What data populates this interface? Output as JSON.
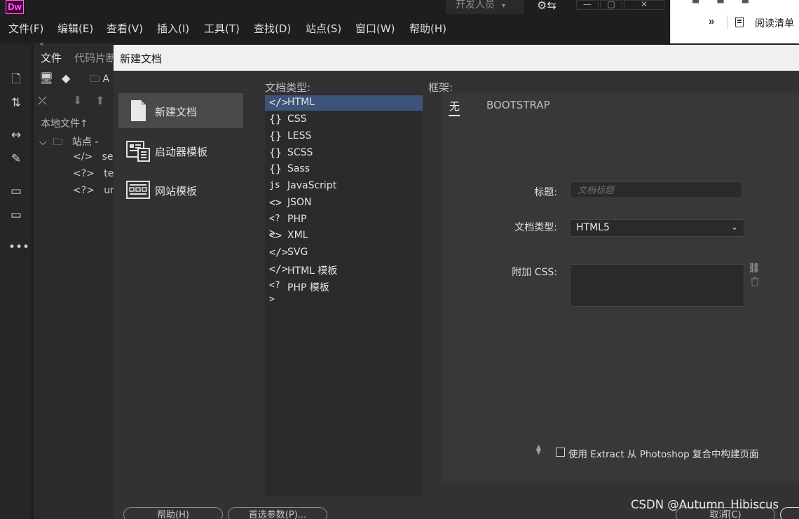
{
  "app": {
    "logo": "Dw",
    "workspace": "开发人员"
  },
  "browser": {
    "more": "»",
    "reading_list": "阅读清单"
  },
  "menu": [
    "文件(F)",
    "编辑(E)",
    "查看(V)",
    "插入(I)",
    "工具(T)",
    "查找(D)",
    "站点(S)",
    "窗口(W)",
    "帮助(H)"
  ],
  "files_panel": {
    "collapse": "«",
    "tabs": [
      "文件",
      "代码片断"
    ],
    "site_dropdown": "A",
    "local_files": "本地文件",
    "tree": [
      {
        "label": "站点 -",
        "icon": "folder-icon"
      },
      {
        "label": "se",
        "icon": "html-file-icon"
      },
      {
        "label": "te",
        "icon": "php-file-icon"
      },
      {
        "label": "un",
        "icon": "php-file-icon"
      }
    ]
  },
  "dialog": {
    "title": "新建文档",
    "categories": [
      {
        "label": "新建文档",
        "icon": "new-document-icon"
      },
      {
        "label": "启动器模板",
        "icon": "starter-template-icon"
      },
      {
        "label": "网站模板",
        "icon": "site-template-icon"
      }
    ],
    "doctype_heading": "文档类型:",
    "doctypes": [
      {
        "label": "HTML",
        "icon": "</>"
      },
      {
        "label": "CSS",
        "icon": "{}"
      },
      {
        "label": "LESS",
        "icon": "{}"
      },
      {
        "label": "SCSS",
        "icon": "{}"
      },
      {
        "label": "Sass",
        "icon": "{}"
      },
      {
        "label": "JavaScript",
        "icon": "js"
      },
      {
        "label": "JSON",
        "icon": "<>"
      },
      {
        "label": "PHP",
        "icon": "<?>"
      },
      {
        "label": "XML",
        "icon": "<>"
      },
      {
        "label": "SVG",
        "icon": "</>"
      },
      {
        "label": "HTML 模板",
        "icon": "</>"
      },
      {
        "label": "PHP 模板",
        "icon": "<?>"
      }
    ],
    "selected_doctype": "HTML",
    "framework_heading": "框架:",
    "framework_tabs": [
      "无",
      "BOOTSTRAP"
    ],
    "form": {
      "title_label": "标题:",
      "title_placeholder": "文档标题",
      "doctype_label": "文档类型:",
      "doctype_value": "HTML5",
      "css_label": "附加 CSS:"
    },
    "extract_label": "使用 Extract 从 Photoshop 复合中构建页面",
    "buttons": {
      "help": "帮助(H)",
      "prefs": "首选参数(P)...",
      "cancel": "取消(C)"
    }
  },
  "watermark": "CSDN @Autumn_Hibiscus"
}
